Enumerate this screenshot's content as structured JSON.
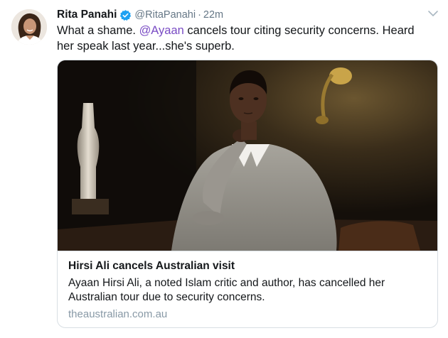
{
  "tweet": {
    "author_name": "Rita Panahi",
    "author_handle": "@RitaPanahi",
    "separator": "·",
    "timestamp": "22m",
    "text_before": "What a shame. ",
    "mention": "@Ayaan",
    "text_after": " cancels tour citing security concerns. Heard her speak last year...she's superb.",
    "icons": {
      "verified": "verified-badge-icon",
      "menu": "chevron-down-icon"
    },
    "colors": {
      "mention": "#794bc4",
      "verified": "#1da1f2",
      "secondary_text": "#657786"
    }
  },
  "card": {
    "title": "Hirsi Ali cancels Australian visit",
    "description": "Ayaan Hirsi Ali, a noted Islam critic and author, has cancelled her Australian tour due to security concerns.",
    "domain": "theaustralian.com.au"
  }
}
